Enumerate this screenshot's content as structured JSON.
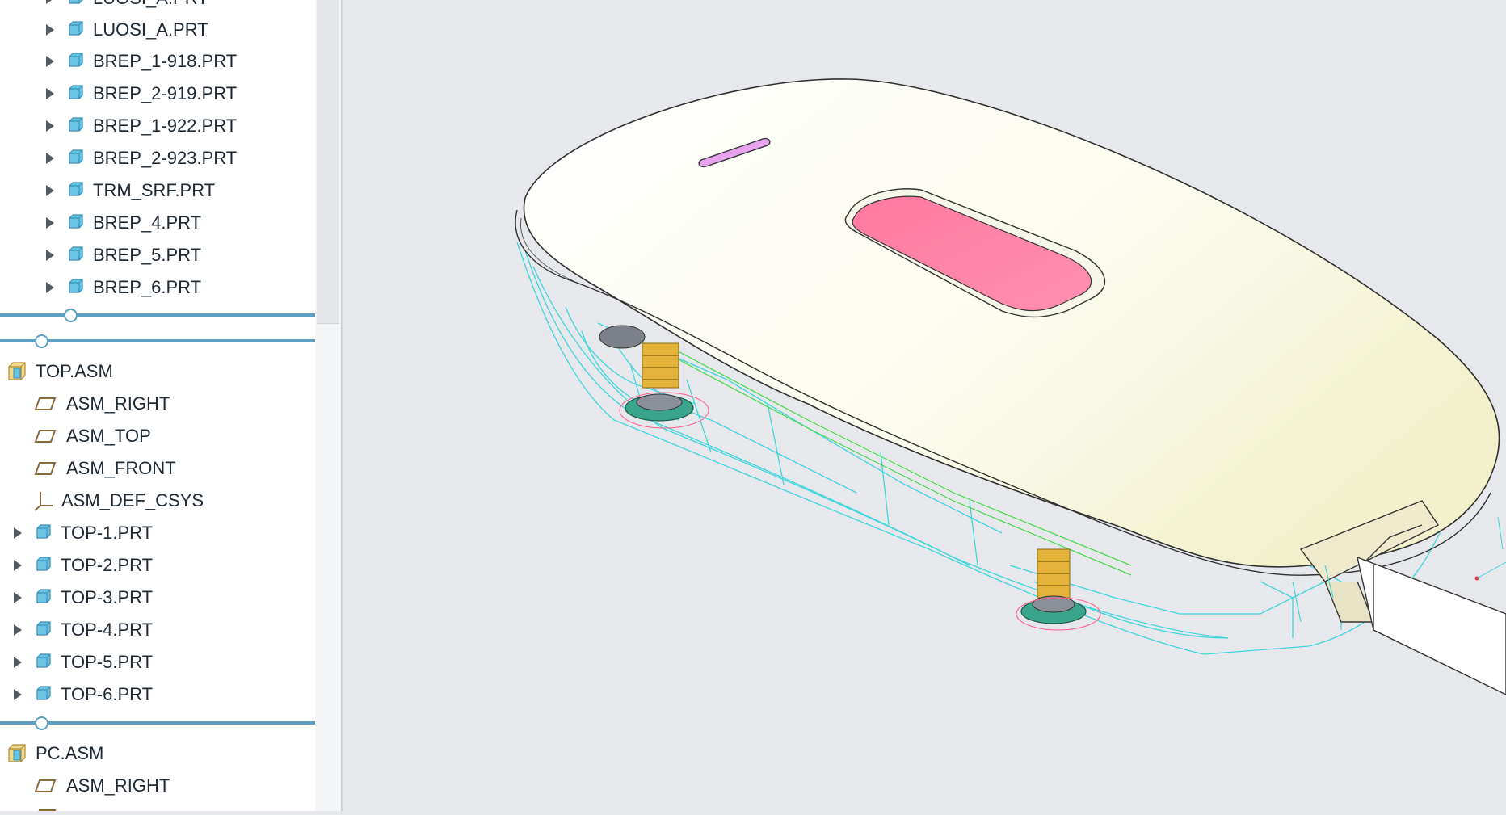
{
  "model_tree": {
    "upper_items": [
      {
        "label": "LUOSI_A.PRT"
      },
      {
        "label": "LUOSI_A.PRT"
      },
      {
        "label": "BREP_1-918.PRT"
      },
      {
        "label": "BREP_2-919.PRT"
      },
      {
        "label": "BREP_1-922.PRT"
      },
      {
        "label": "BREP_2-923.PRT"
      },
      {
        "label": "TRM_SRF.PRT"
      },
      {
        "label": "BREP_4.PRT"
      },
      {
        "label": "BREP_5.PRT"
      },
      {
        "label": "BREP_6.PRT"
      }
    ],
    "top_asm": {
      "label": "TOP.ASM",
      "datums": [
        {
          "label": "ASM_RIGHT",
          "icon": "datum-plane-icon"
        },
        {
          "label": "ASM_TOP",
          "icon": "datum-plane-icon"
        },
        {
          "label": "ASM_FRONT",
          "icon": "datum-plane-icon"
        },
        {
          "label": "ASM_DEF_CSYS",
          "icon": "coordinate-system-icon"
        }
      ],
      "parts": [
        {
          "label": "TOP-1.PRT"
        },
        {
          "label": "TOP-2.PRT"
        },
        {
          "label": "TOP-3.PRT"
        },
        {
          "label": "TOP-4.PRT"
        },
        {
          "label": "TOP-5.PRT"
        },
        {
          "label": "TOP-6.PRT"
        }
      ]
    },
    "pc_asm": {
      "label": "PC.ASM",
      "datums": [
        {
          "label": "ASM_RIGHT",
          "icon": "datum-plane-icon"
        }
      ]
    }
  },
  "colors": {
    "accent_divider": "#5b9fc2",
    "part_icon": "#6cc4e4",
    "shell_body": "#fbfbee",
    "button_pink": "#ff86a9",
    "slot_violet": "#e7a3ee",
    "wireframe_cyan": "#3fd6dc",
    "wireframe_green": "#46d84a",
    "viewport_background": "#e6e8ec"
  }
}
